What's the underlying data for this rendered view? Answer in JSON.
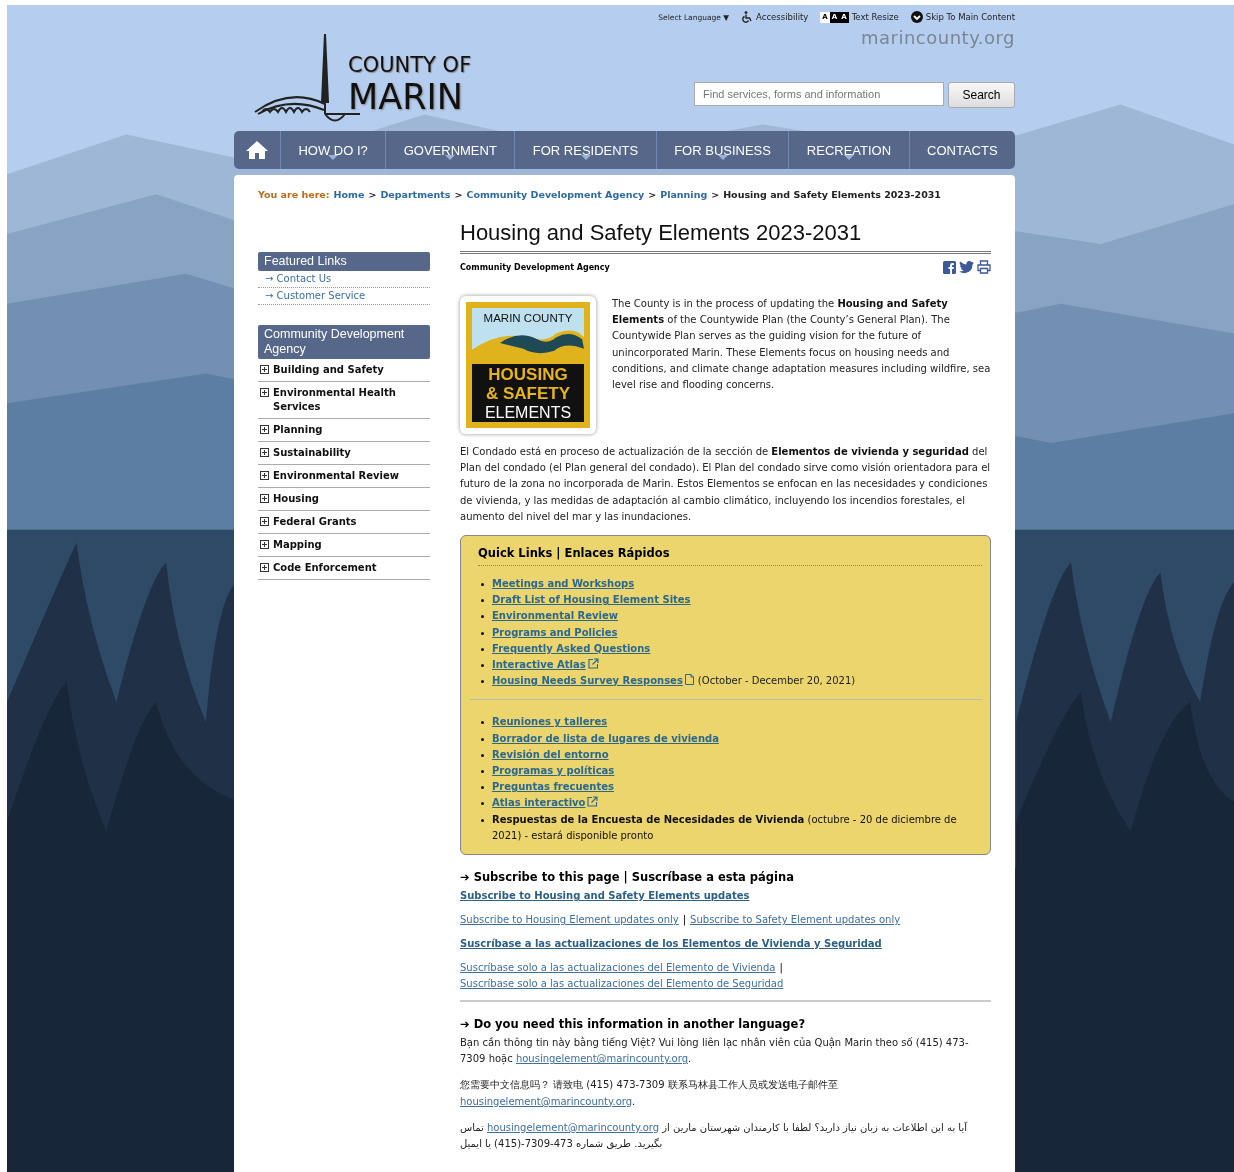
{
  "utility_bar": {
    "language": "Select Language",
    "language_caret": "▼",
    "accessibility": "Accessibility",
    "text_resize_letters": [
      "A",
      "A",
      "A"
    ],
    "text_resize": "Text Resize",
    "skip": "Skip To Main Content"
  },
  "site_url": "marincounty.org",
  "logo": {
    "line1": "COUNTY OF",
    "line2": "MARIN"
  },
  "search": {
    "placeholder": "Find services, forms and information",
    "button": "Search"
  },
  "nav": [
    {
      "label": "HOW DO I?",
      "has_menu": true
    },
    {
      "label": "GOVERNMENT",
      "has_menu": true
    },
    {
      "label": "FOR RESIDENTS",
      "has_menu": true
    },
    {
      "label": "FOR BUSINESS",
      "has_menu": true
    },
    {
      "label": "RECREATION",
      "has_menu": true
    },
    {
      "label": "CONTACTS",
      "has_menu": false
    }
  ],
  "breadcrumb": {
    "label": "You are here:",
    "links": [
      "Home",
      "Departments",
      "Community Development Agency",
      "Planning"
    ],
    "separator": ">",
    "current": "Housing and Safety Elements 2023-2031"
  },
  "sidebar": {
    "featured_title": "Featured Links",
    "featured_links": [
      "→ Contact Us",
      "→ Customer Service"
    ],
    "section_title": "Community Development Agency",
    "items": [
      "Building and Safety",
      "Environmental Health Services",
      "Planning",
      "Sustainability",
      "Environmental Review",
      "Housing",
      "Federal Grants",
      "Mapping",
      "Code Enforcement"
    ]
  },
  "page_title": "Housing and Safety Elements 2023-2031",
  "department": "Community Development Agency",
  "feature_logo": {
    "top": "MARIN COUNTY",
    "line1": "HOUSING",
    "line2": "& SAFETY",
    "line3": "ELEMENTS"
  },
  "intro": [
    "The County is in the process of updating the **Housing and Safety Elements** of the Countywide Plan (the County’s General Plan). The Countywide Plan serves as the guiding vision for the future of unincorporated Marin. These Elements focus on housing needs and conditions, and climate change adaptation measures including wildfire, sea level rise and flooding concerns.",
    "El Condado está en proceso de actualización de la sección de **Elementos de vivienda y seguridad** del Plan del condado (el Plan general del condado). El Plan del condado sirve como visión orientadora para el futuro de la zona no incorporada de Marin. Estos Elementos se enfocan en las necesidades y condiciones de vivienda, y las medidas de adaptación al cambio climático, incluyendo los incendios forestales, el aumento del nivel del mar y las inundaciones."
  ],
  "quick_links": {
    "title": "Quick Links | Enlaces Rápidos",
    "groups": [
      [
        {
          "kind": "link",
          "label": "Meetings and Workshops"
        },
        {
          "kind": "link",
          "label": "Draft List of Housing Element Sites"
        },
        {
          "kind": "link",
          "label": "Environmental Review"
        },
        {
          "kind": "link",
          "label": "Programs and Policies"
        },
        {
          "kind": "link",
          "label": "Frequently Asked Questions"
        },
        {
          "kind": "external",
          "label": "Interactive Atlas"
        },
        {
          "kind": "document",
          "label": "Housing Needs Survey Responses",
          "note": "(October - December 20, 2021)"
        }
      ],
      [
        {
          "kind": "link",
          "label": "Reuniones y talleres"
        },
        {
          "kind": "link",
          "label": "Borrador de lista de lugares de vivienda"
        },
        {
          "kind": "link",
          "label": "Revisión del entorno"
        },
        {
          "kind": "link",
          "label": "Programas y políticas"
        },
        {
          "kind": "link",
          "label": "Preguntas frecuentes"
        },
        {
          "kind": "external",
          "label": "Atlas interactivo"
        },
        {
          "kind": "text",
          "label": "**Respuestas de la Encuesta de Necesidades de Vivienda** (octubre - 20 de diciembre de 2021) - estará disponible pronto"
        }
      ]
    ]
  },
  "subscribe": {
    "heading": "➔ Subscribe to this page | Suscríbase a esta página",
    "blocks": [
      {
        "kind": "main",
        "links": [
          "Subscribe to Housing and Safety Elements updates"
        ]
      },
      {
        "kind": "pair",
        "links": [
          "Subscribe to Housing Element updates only",
          "Subscribe to Safety Element updates only"
        ]
      },
      {
        "kind": "main",
        "links": [
          "Suscríbase a las actualizaciones de los Elementos de Vivienda y Seguridad"
        ]
      },
      {
        "kind": "pair",
        "links": [
          "Suscríbase solo a las actualizaciones del Elemento de Vivienda",
          "Suscríbase solo a las actualizaciones del Elemento de Seguridad"
        ]
      }
    ],
    "separator": "|"
  },
  "languages": {
    "heading": "➔ Do you need this information in another language?",
    "paragraphs": [
      {
        "kind": "ltr",
        "before": "Bạn cần thông tin này bằng tiếng Việt? Vui lòng liên lạc nhân viên của Quận Marin theo số (415) 473-7309 hoặc",
        "link": "housingelement@marincounty.org",
        "after": "."
      },
      {
        "kind": "ltr",
        "before": "您需要中文信息吗？ 请致电 (415) 473-7309 联系马林县工作人员或发送电子邮件至",
        "link": "housingelement@marincounty.org",
        "after": "."
      },
      {
        "kind": "rtl",
        "before": "آیا به این اطلاعات به زبان نیاز دارید؟ لطفا با کارمندان شهرستان مارین از",
        "link": "housingelement@marincounty.org",
        "after": "تماس بگیرید. طریق شماره 473-7309-(415) یا ایمیل"
      }
    ]
  }
}
